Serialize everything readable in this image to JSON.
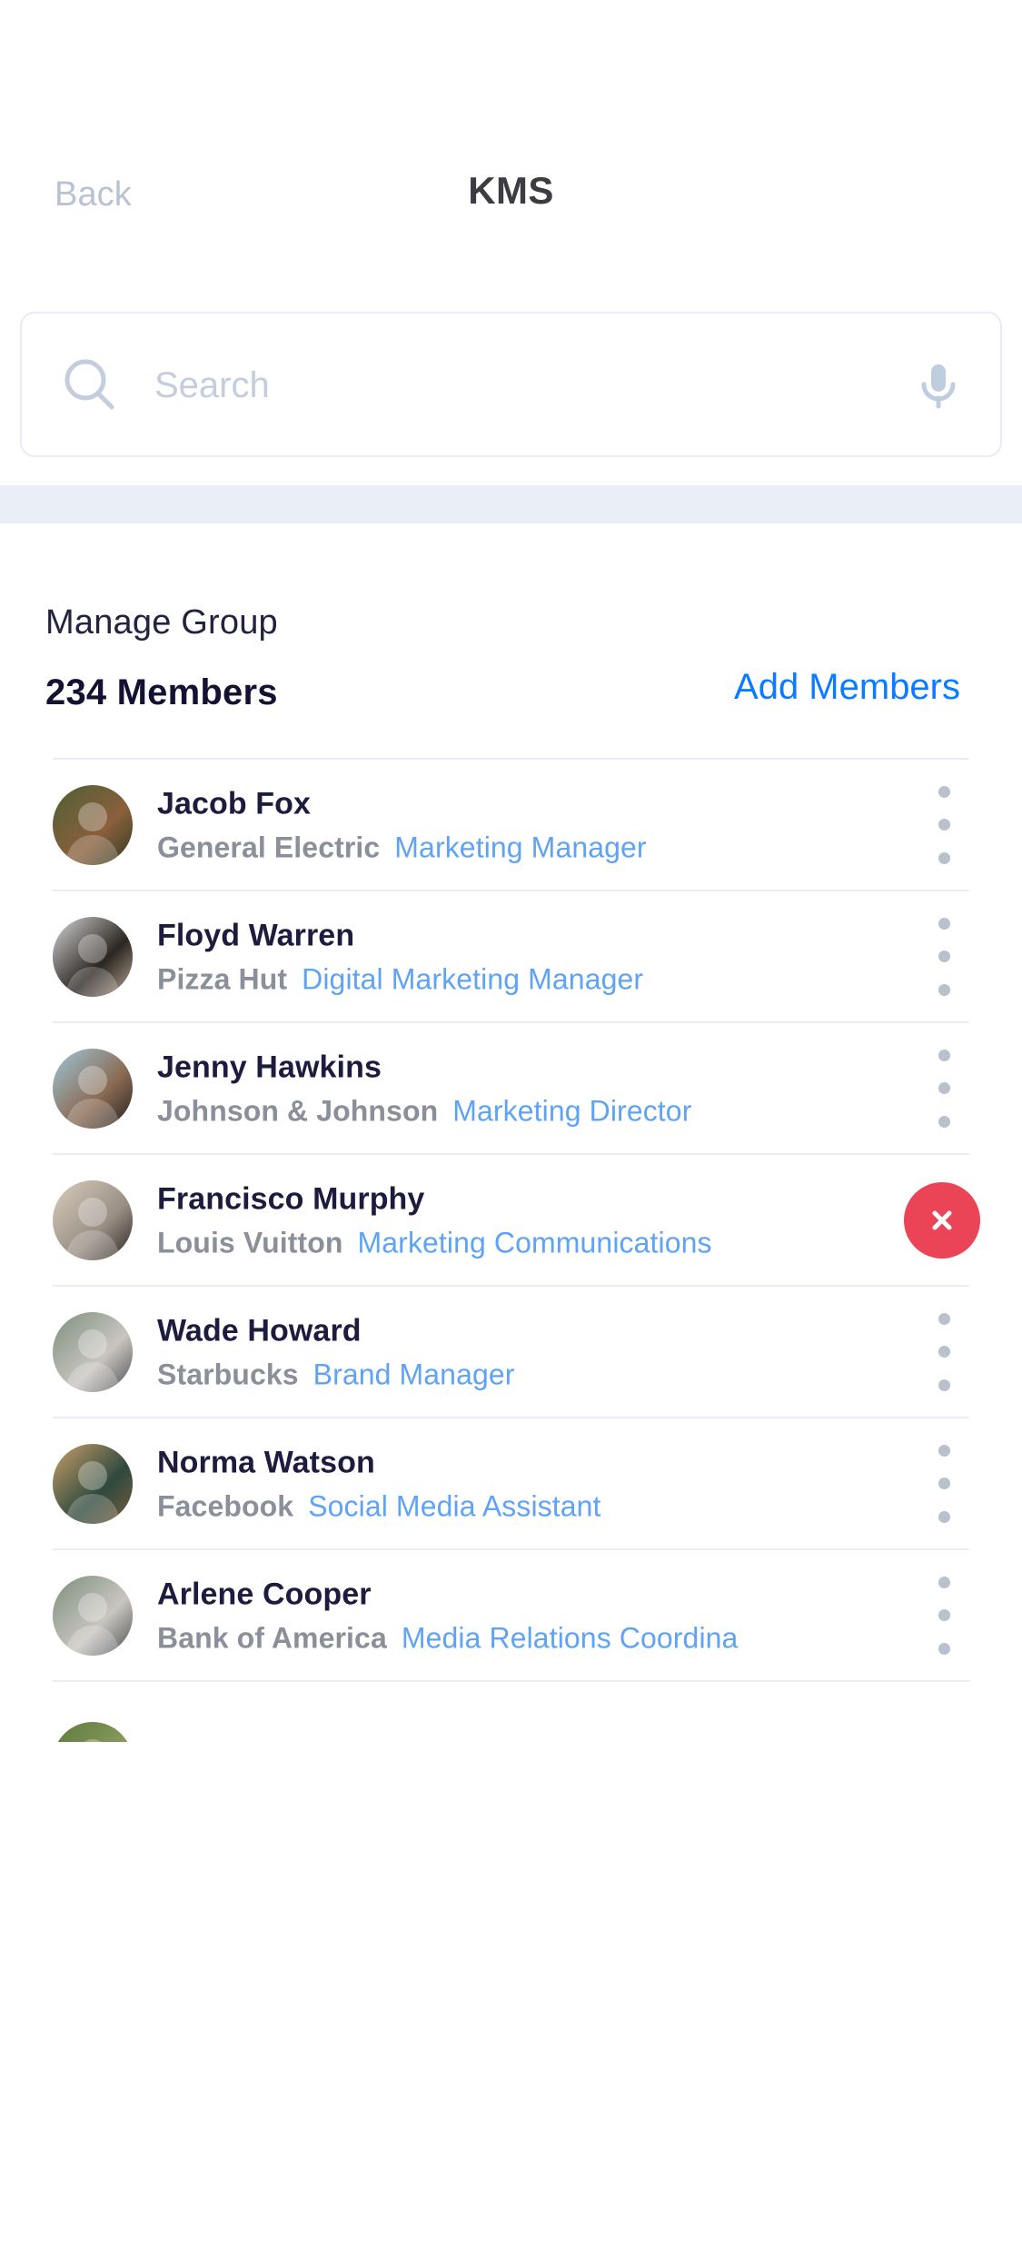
{
  "navbar": {
    "back_label": "Back",
    "title": "KMS",
    "back_icon": "back-chevron"
  },
  "search": {
    "placeholder": "Search",
    "value": "",
    "search_icon": "search-icon",
    "mic_icon": "microphone-icon"
  },
  "section": {
    "title": "Manage Group",
    "member_count_label": "234 Members",
    "add_members_label": "Add Members"
  },
  "colors": {
    "accent_blue": "#0b7bff",
    "role_blue": "#5fa3f5",
    "name_navy": "#1d1c3f",
    "company_gray": "#8a8f99",
    "danger_red": "#ea4456",
    "band_gray": "#eaeef6",
    "divider": "#eaeef4",
    "placeholder": "#c3cddd",
    "back_gray": "#b9c2d0"
  },
  "members": [
    {
      "name": "Jacob Fox",
      "company": "General Electric",
      "role": "Marketing Manager",
      "action": "kebab",
      "truncated": false,
      "avatar_colors": [
        "#4e6036",
        "#8a5f3c",
        "#2f3b22"
      ]
    },
    {
      "name": "Floyd Warren",
      "company": "Pizza Hut",
      "role": "Digital Marketing Manager",
      "action": "kebab",
      "truncated": false,
      "avatar_colors": [
        "#d8d8d8",
        "#2b2622",
        "#b9a894"
      ]
    },
    {
      "name": "Jenny Hawkins",
      "company": "Johnson & Johnson",
      "role": "Marketing Director",
      "action": "kebab",
      "truncated": false,
      "avatar_colors": [
        "#9ec6d8",
        "#8a6a52",
        "#20201e"
      ]
    },
    {
      "name": "Francisco Murphy",
      "company": "Louis Vuitton",
      "role": "Marketing Communications",
      "action": "remove",
      "truncated": true,
      "avatar_colors": [
        "#d8cdbc",
        "#9a8f85",
        "#2a2420"
      ]
    },
    {
      "name": "Wade Howard",
      "company": "Starbucks",
      "role": "Brand Manager",
      "action": "kebab",
      "truncated": false,
      "avatar_colors": [
        "#7c8f7c",
        "#c9c5c0",
        "#4b4f52"
      ]
    },
    {
      "name": "Norma Watson",
      "company": "Facebook",
      "role": "Social Media Assistant",
      "action": "kebab",
      "truncated": false,
      "avatar_colors": [
        "#c9a06a",
        "#2f4a3e",
        "#7a5b3a"
      ]
    },
    {
      "name": "Arlene Cooper",
      "company": "Bank of America",
      "role": "Media Relations Coordina",
      "action": "kebab",
      "truncated": true,
      "avatar_colors": [
        "#7c8f7c",
        "#c9c5c0",
        "#4b4f52"
      ]
    }
  ],
  "partial_row": {
    "avatar_colors": [
      "#5c7a3e",
      "#8a9a5c",
      "#3a4a26"
    ]
  }
}
